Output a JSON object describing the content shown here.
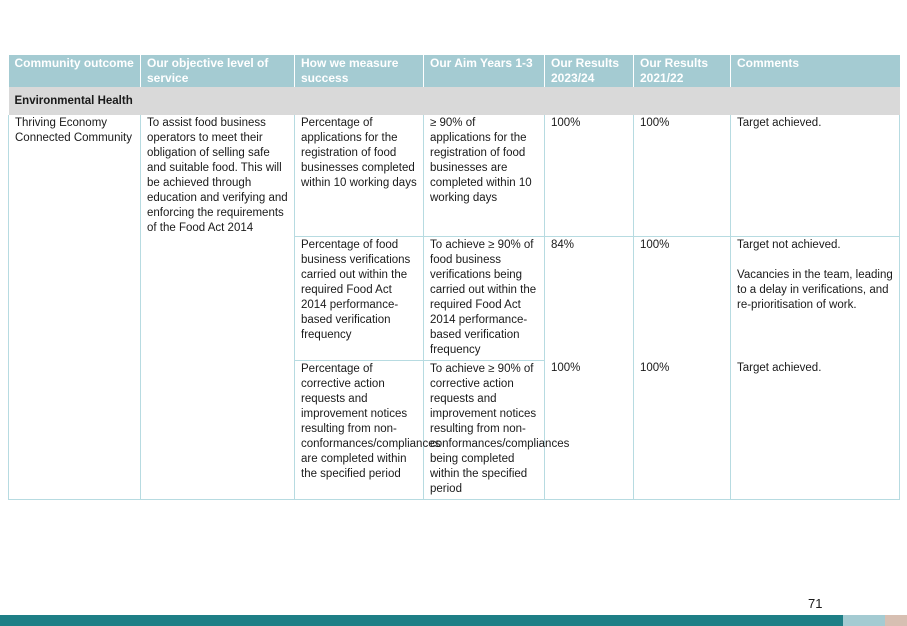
{
  "table": {
    "headers": [
      "Community outcome",
      "Our objective level of service",
      "How we measure success",
      "Our Aim Years 1-3",
      "Our Results 2023/24",
      "Our Results 2021/22",
      "Comments"
    ],
    "section_title": "Environmental Health",
    "community_outcome": "Thriving Economy Connected Community",
    "objective": "To assist food business operators to meet their obligation of selling safe and suitable food. This will be achieved through education and verifying and enforcing the requirements of the Food Act 2014",
    "rows": [
      {
        "measure": "Percentage of applications for the registration of food businesses completed within 10 working days",
        "aim": "≥ 90% of applications for the registration of food businesses are completed within 10 working days",
        "result_2023_24": "100%",
        "result_2021_22": "100%",
        "comments": [
          "Target achieved."
        ]
      },
      {
        "measure": "Percentage of food business verifications carried out within the required Food Act 2014 performance-based verification frequency",
        "aim": "To achieve ≥ 90% of food business verifications being carried out within the required Food Act 2014 performance-based verification frequency",
        "result_2023_24": "84%",
        "result_2021_22": "100%",
        "comments": [
          "Target not achieved.",
          "Vacancies in the team, leading to a delay in verifications, and re-prioritisation of work."
        ]
      },
      {
        "measure": "Percentage of corrective action requests and improvement notices resulting from non-conformances/compliances are completed within the specified period",
        "aim": "To achieve ≥ 90% of corrective action requests and improvement notices resulting from non-conformances/compliances being completed within the specified period",
        "result_2023_24": "100%",
        "result_2021_22": "100%",
        "comments": [
          "Target achieved."
        ]
      }
    ]
  },
  "page_number": "71",
  "colors": {
    "header_bg": "#a4cbd2",
    "section_bg": "#d9d9d9",
    "footer_teal": "#1e7f86",
    "footer_light": "#a4cbd2",
    "footer_sand": "#d7bfb2"
  }
}
